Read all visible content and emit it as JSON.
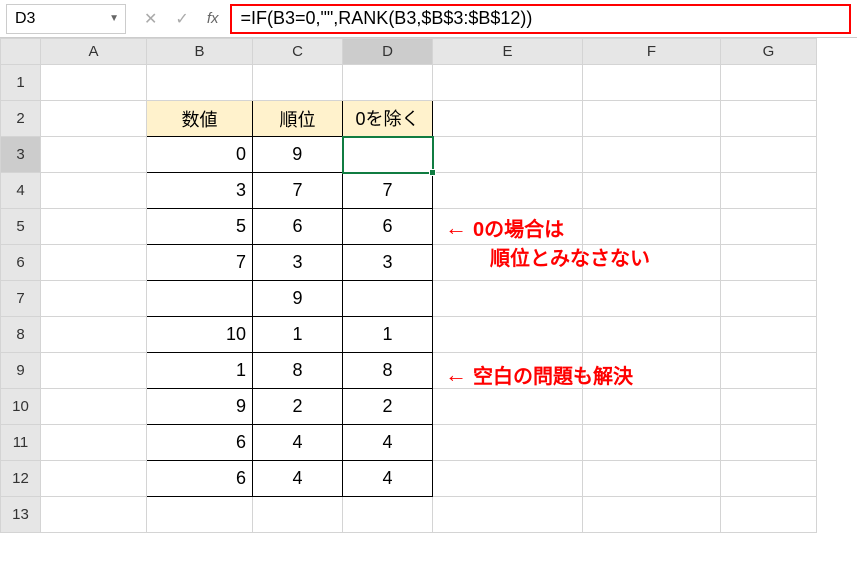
{
  "namebox": "D3",
  "formula": "=IF(B3=0,\"\",RANK(B3,$B$3:$B$12))",
  "columns": [
    "A",
    "B",
    "C",
    "D",
    "E",
    "F",
    "G"
  ],
  "row_labels": [
    "1",
    "2",
    "3",
    "4",
    "5",
    "6",
    "7",
    "8",
    "9",
    "10",
    "11",
    "12",
    "13"
  ],
  "headers": {
    "b": "数値",
    "c": "順位",
    "d": "0を除く"
  },
  "rows": [
    {
      "b": "0",
      "c": "9",
      "d": ""
    },
    {
      "b": "3",
      "c": "7",
      "d": "7"
    },
    {
      "b": "5",
      "c": "6",
      "d": "6"
    },
    {
      "b": "7",
      "c": "3",
      "d": "3"
    },
    {
      "b": "",
      "c": "9",
      "d": ""
    },
    {
      "b": "10",
      "c": "1",
      "d": "1"
    },
    {
      "b": "1",
      "c": "8",
      "d": "8"
    },
    {
      "b": "9",
      "c": "2",
      "d": "2"
    },
    {
      "b": "6",
      "c": "4",
      "d": "4"
    },
    {
      "b": "6",
      "c": "4",
      "d": "4"
    }
  ],
  "annotations": {
    "a1_line1": "0の場合は",
    "a1_line2": "順位とみなさない",
    "a2": "空白の問題も解決",
    "arrow": "←"
  }
}
